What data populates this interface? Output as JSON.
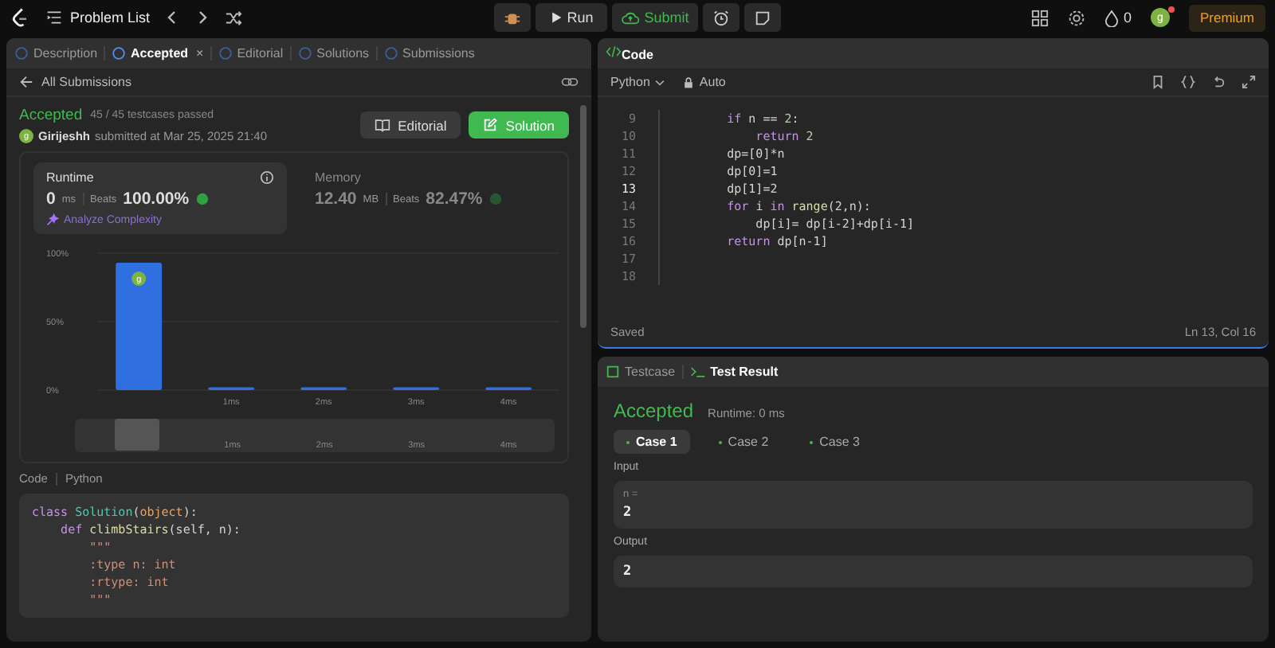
{
  "topbar": {
    "problem_list": "Problem List",
    "run": "Run",
    "submit": "Submit",
    "streak": "0",
    "avatar": "g",
    "notification": true,
    "premium": "Premium"
  },
  "left": {
    "tabs": [
      {
        "label": "Description",
        "selected": false
      },
      {
        "label": "Accepted",
        "selected": true,
        "close": "×"
      },
      {
        "label": "Editorial",
        "selected": false
      },
      {
        "label": "Solutions",
        "selected": false
      },
      {
        "label": "Submissions",
        "selected": false
      }
    ],
    "back": "All Submissions",
    "status": "Accepted",
    "passed": "45 / 45 testcases passed",
    "user_avatar": "g",
    "user": "Girijeshh",
    "submitted": "submitted at Mar 25, 2025 21:40",
    "buttons": [
      {
        "label": "Editorial",
        "kind": "plain"
      },
      {
        "label": "Solution",
        "kind": "primary"
      }
    ],
    "stats": [
      {
        "title": "Runtime",
        "selected": true,
        "value": "0",
        "unit": "ms",
        "beats": "Beats",
        "percent": "100.00%",
        "action": "Analyze Complexity"
      },
      {
        "title": "Memory",
        "selected": false,
        "value": "12.40",
        "unit": "MB",
        "beats": "Beats",
        "percent": "82.47%"
      }
    ],
    "chart": {
      "marker": "g",
      "scrubber_labels": [
        "1ms",
        "2ms",
        "3ms",
        "4ms"
      ],
      "chart_data": {
        "type": "bar",
        "categories": [
          null,
          "1ms",
          "2ms",
          "3ms",
          "4ms"
        ],
        "series": [
          {
            "color": "#2f6fe0",
            "values": [
              93,
              2,
              2,
              2,
              2
            ]
          }
        ],
        "ylim": [
          0,
          100
        ],
        "yticks": [
          {
            "value": 0,
            "label": "0%"
          },
          {
            "value": 50,
            "label": "50%"
          },
          {
            "value": 100,
            "label": "100%"
          }
        ]
      }
    },
    "code_header": "Code",
    "code_lang": "Python",
    "code": [
      [
        {
          "t": "class ",
          "kind": "kw"
        },
        {
          "t": "Solution",
          "kind": "cls"
        },
        {
          "t": "(",
          "kind": "p"
        },
        {
          "t": "object",
          "kind": "arg"
        },
        {
          "t": "):",
          "kind": "p"
        }
      ],
      [
        {
          "t": "    def ",
          "kind": "kw"
        },
        {
          "t": "climbStairs",
          "kind": "fn"
        },
        {
          "t": "(self, n):",
          "kind": "p"
        }
      ],
      [
        {
          "t": "        \"\"\"",
          "kind": "str"
        }
      ],
      [
        {
          "t": "        :type n: int",
          "kind": "str"
        }
      ],
      [
        {
          "t": "        :rtype: int",
          "kind": "str"
        }
      ],
      [
        {
          "t": "        \"\"\"",
          "kind": "str"
        }
      ]
    ]
  },
  "editor": {
    "title": "Code",
    "language": "Python",
    "mode": "Auto",
    "lines": [
      {
        "no": "9",
        "current": false,
        "tokens": [
          {
            "t": "        if ",
            "kind": "kw"
          },
          {
            "t": "n == ",
            "kind": "p"
          },
          {
            "t": "2",
            "kind": "num"
          },
          {
            "t": ":",
            "kind": "p"
          }
        ]
      },
      {
        "no": "10",
        "current": false,
        "tokens": [
          {
            "t": "            return ",
            "kind": "kw"
          },
          {
            "t": "2",
            "kind": "num"
          }
        ]
      },
      {
        "no": "11",
        "current": false,
        "tokens": [
          {
            "t": "        dp=[0]*n",
            "kind": "p"
          }
        ]
      },
      {
        "no": "12",
        "current": false,
        "tokens": [
          {
            "t": "        dp[0]=1",
            "kind": "p"
          }
        ]
      },
      {
        "no": "13",
        "current": true,
        "tokens": [
          {
            "t": "        dp[1]=2",
            "kind": "p"
          }
        ]
      },
      {
        "no": "14",
        "current": false,
        "tokens": [
          {
            "t": "        for ",
            "kind": "kw"
          },
          {
            "t": "i ",
            "kind": "p"
          },
          {
            "t": "in ",
            "kind": "kw"
          },
          {
            "t": "range",
            "kind": "fn"
          },
          {
            "t": "(2,n):",
            "kind": "p"
          }
        ]
      },
      {
        "no": "15",
        "current": false,
        "tokens": [
          {
            "t": "            dp[i]= dp[i-2]+dp[i-1]",
            "kind": "p"
          }
        ]
      },
      {
        "no": "16",
        "current": false,
        "tokens": [
          {
            "t": "        return ",
            "kind": "kw"
          },
          {
            "t": "dp[n-1]",
            "kind": "p"
          }
        ]
      },
      {
        "no": "17",
        "current": false
      },
      {
        "no": "18",
        "current": false
      }
    ],
    "saved": "Saved",
    "cursor": "Ln 13, Col 16"
  },
  "results": {
    "tabs": [
      {
        "label": "Testcase",
        "selected": false
      },
      {
        "label": "Test Result",
        "selected": true
      }
    ],
    "status": "Accepted",
    "runtime": "Runtime: 0 ms",
    "cases": [
      {
        "label": "Case 1",
        "selected": true
      },
      {
        "label": "Case 2",
        "selected": false
      },
      {
        "label": "Case 3",
        "selected": false
      }
    ],
    "input_label": "Input",
    "input_var": "n =",
    "input_value": "2",
    "output_label": "Output",
    "output_value": "2"
  }
}
